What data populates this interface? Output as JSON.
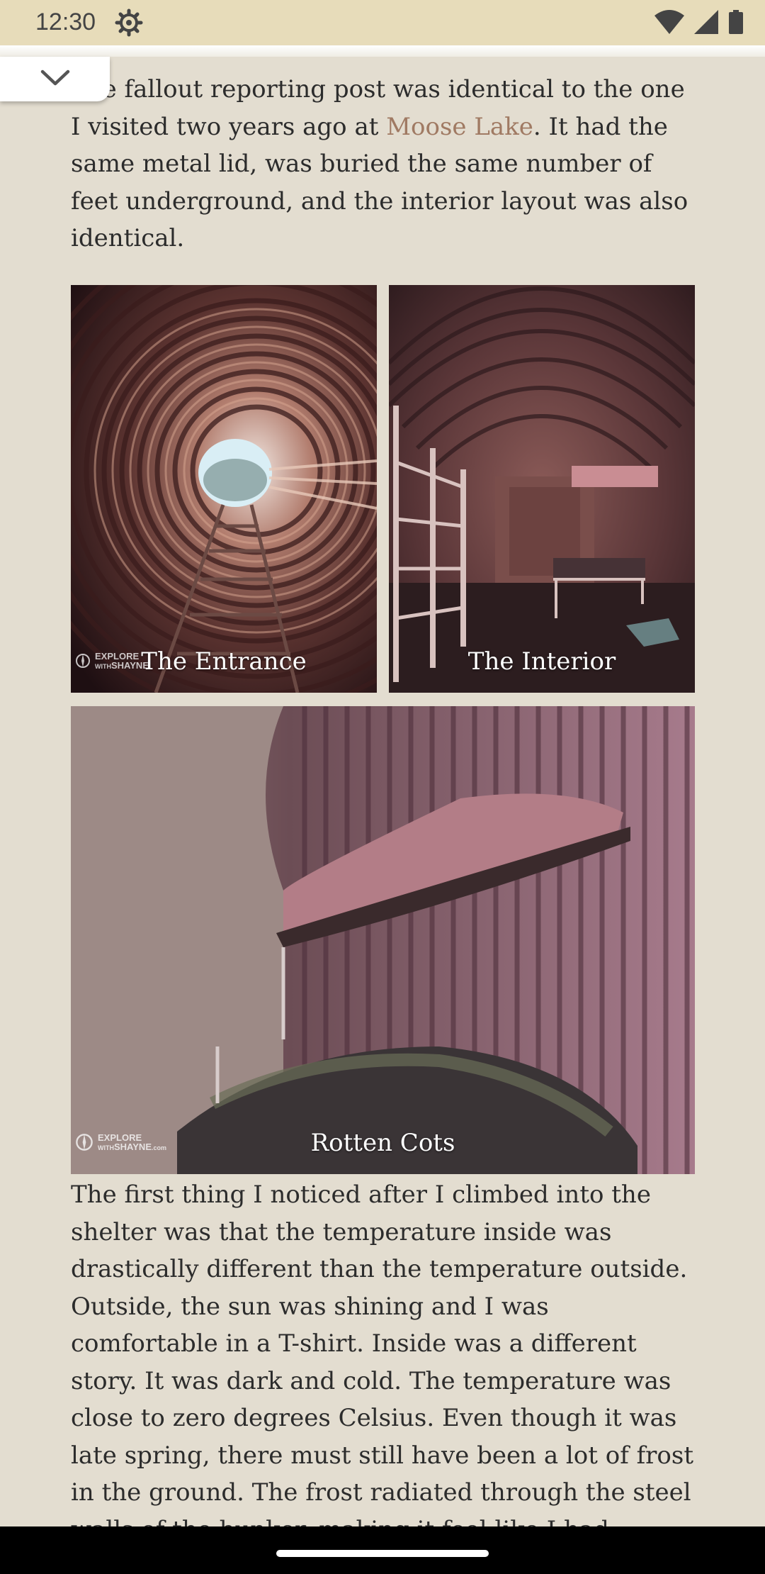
{
  "status_bar": {
    "time": "12:30",
    "icons": [
      "settings-gear-icon",
      "wifi-icon",
      "cell-signal-icon",
      "battery-icon"
    ]
  },
  "collapse_button": {
    "icon": "chevron-down-icon"
  },
  "article": {
    "paragraph1": {
      "before_link": "The fallout reporting post was identical to the one I visited two years ago at ",
      "link_text": "Moose Lake",
      "after_link": ". It had the same metal lid, was buried the same number of feet underground, and the interior layout was also identical."
    },
    "photos": [
      {
        "caption": "The Entrance"
      },
      {
        "caption": "The Interior"
      },
      {
        "caption": "Rotten Cots"
      }
    ],
    "watermark": {
      "line1": "EXPLORE",
      "line2": "WITH",
      "line3": "SHAYNE",
      "suffix": ".com"
    },
    "paragraph2": "The first thing I noticed after I climbed into the shelter was that the temperature inside was drastically different than the temperature outside. Outside, the sun was shining and I was comfortable in a T-shirt. Inside was a different story. It was dark and cold. The temperature was close to zero degrees Celsius. Even though it was late spring, there must still have been a lot of frost in the ground. The frost radiated through the steel walls of the bunker, making it feel like I had descended into a different time and place."
  },
  "colors": {
    "background": "#e3ddd0",
    "status_bar": "#e7dcba",
    "link": "#a07a63",
    "text": "#2c2c2c"
  }
}
